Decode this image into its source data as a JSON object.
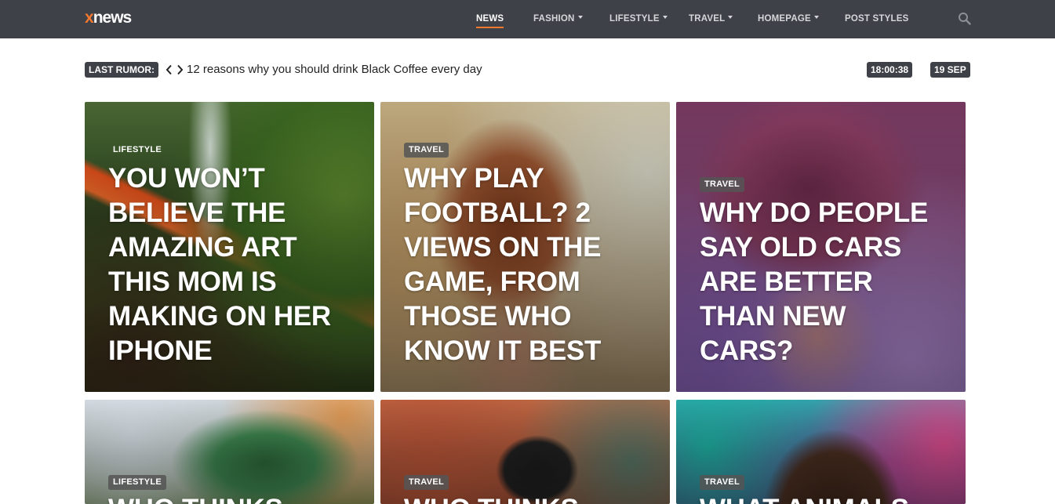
{
  "brand": {
    "logo_prefix": "x",
    "logo_rest": "news",
    "accent_color": "#f2772f",
    "bar_color": "#3f4148"
  },
  "nav": {
    "items": [
      {
        "label": "NEWS",
        "dropdown": false,
        "active": true
      },
      {
        "label": "FASHION",
        "dropdown": true,
        "active": false
      },
      {
        "label": "LIFESTYLE",
        "dropdown": true,
        "active": false
      },
      {
        "label": "TRAVEL",
        "dropdown": true,
        "active": false
      },
      {
        "label": "HOMEPAGE",
        "dropdown": true,
        "active": false
      },
      {
        "label": "POST STYLES",
        "dropdown": false,
        "active": false
      }
    ],
    "search_icon": "search-icon"
  },
  "ticker": {
    "label": "LAST RUMOR:",
    "headline": "12 reasons why you should drink Black Coffee every day",
    "time": "18:00:38",
    "date": "19 SEP",
    "prev_icon": "chevron-left-icon",
    "next_icon": "chevron-right-icon"
  },
  "cards": [
    {
      "category": "LIFESTYLE",
      "title": "YOU WON’T BELIEVE THE AMAZING ART THIS MOM IS MAKING ON HER IPHONE"
    },
    {
      "category": "TRAVEL",
      "title": "WHY PLAY FOOTBALL? 2 VIEWS ON THE GAME, FROM THOSE WHO KNOW IT BEST"
    },
    {
      "category": "TRAVEL",
      "title": "WHY DO PEOPLE SAY OLD CARS ARE BETTER THAN NEW CARS?"
    },
    {
      "category": "LIFESTYLE",
      "title": "WHO THINKS"
    },
    {
      "category": "TRAVEL",
      "title": "WHO THINKS"
    },
    {
      "category": "TRAVEL",
      "title": "WHAT ANIMALS"
    }
  ]
}
